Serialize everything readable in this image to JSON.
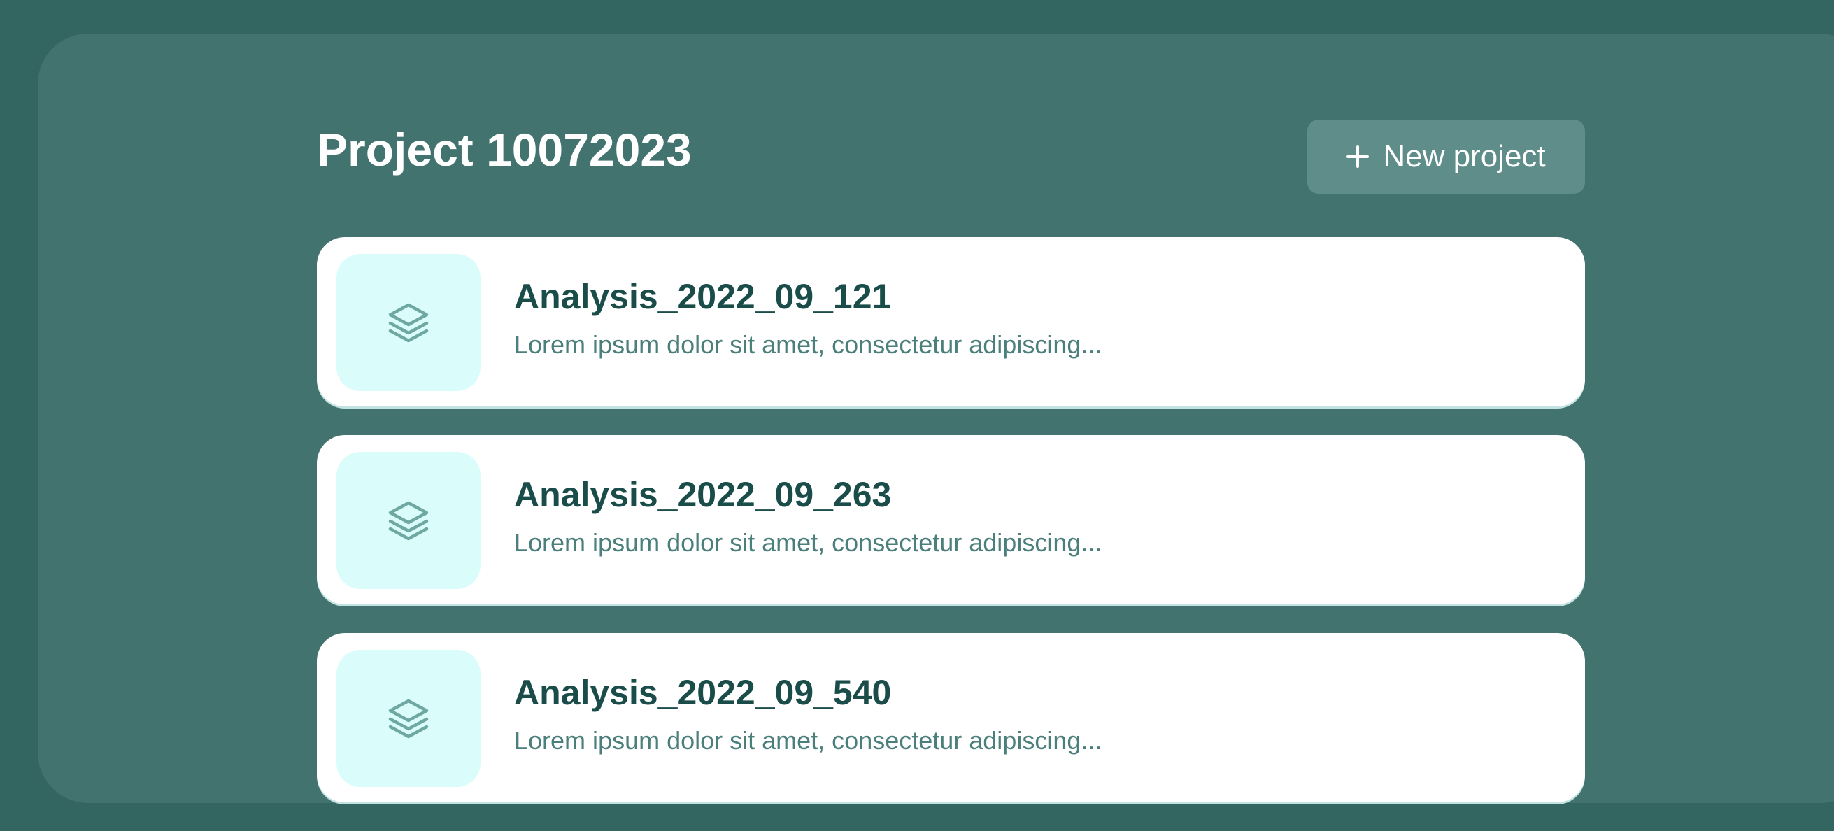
{
  "header": {
    "title": "Project 10072023",
    "new_project_label": "New project"
  },
  "icons": {
    "new_project": "plus-icon",
    "item": "layers-icon"
  },
  "colors": {
    "background": "#336561",
    "panel": "#42736F",
    "button": "#5F8E8A",
    "card": "#FFFFFF",
    "thumb": "#DAFDFB",
    "title_text": "#1A4D49",
    "desc_text": "#4B7F7B",
    "icon": "#6FA7A3"
  },
  "items": [
    {
      "title": "Analysis_2022_09_121",
      "description": "Lorem ipsum dolor sit amet, consectetur adipiscing..."
    },
    {
      "title": "Analysis_2022_09_263",
      "description": "Lorem ipsum dolor sit amet, consectetur adipiscing..."
    },
    {
      "title": "Analysis_2022_09_540",
      "description": "Lorem ipsum dolor sit amet, consectetur adipiscing..."
    }
  ]
}
